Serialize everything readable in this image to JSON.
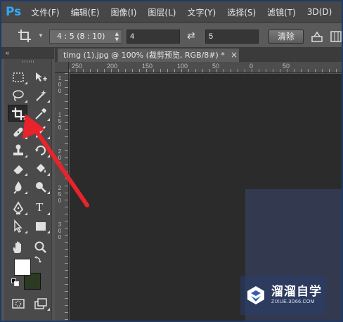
{
  "app": {
    "logo_text": "Ps"
  },
  "menu": [
    {
      "label": "文件(F)"
    },
    {
      "label": "编辑(E)"
    },
    {
      "label": "图像(I)"
    },
    {
      "label": "图层(L)"
    },
    {
      "label": "文字(Y)"
    },
    {
      "label": "选择(S)"
    },
    {
      "label": "滤镜(T)"
    },
    {
      "label": "3D(D)"
    }
  ],
  "options_bar": {
    "ratio_select": "4 : 5 (8 : 10)",
    "width_value": "4",
    "height_value": "5",
    "clear_label": "清除"
  },
  "toolbox": {
    "collapse_glyph": "«",
    "foreground_color": "#ffffff",
    "background_color": "#2b3a22"
  },
  "document": {
    "tab_title": "timg (1).jpg @ 100% (裁剪预览, RGB/8#) *",
    "close_glyph": "×"
  },
  "ruler": {
    "horizontal_labels": [
      "250",
      "200",
      "150",
      "100",
      "50",
      "0",
      "50"
    ],
    "vertical_labels": [
      "1",
      "0",
      "0",
      "1",
      "5",
      "0",
      "2",
      "0",
      "0",
      "2",
      "5",
      "0",
      "3",
      "0",
      "0"
    ]
  },
  "watermark": {
    "title": "溜溜自学",
    "url": "ZIXUE.3D66.COM"
  },
  "colors": {
    "arrow": "#e8232b",
    "ps_blue": "#31a8ff"
  }
}
